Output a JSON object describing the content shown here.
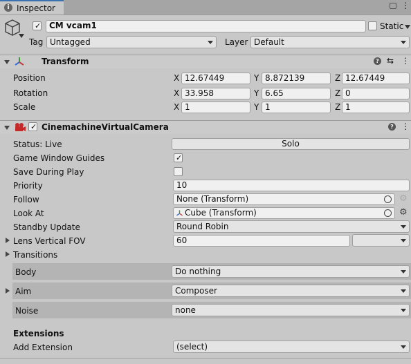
{
  "tab": {
    "label": "Inspector",
    "icon": "info-icon"
  },
  "object": {
    "name": "CM vcam1",
    "static_label": "Static",
    "tag_label": "Tag",
    "tag_value": "Untagged",
    "layer_label": "Layer",
    "layer_value": "Default"
  },
  "transform": {
    "title": "Transform",
    "rows": [
      {
        "label": "Position",
        "x": "12.67449",
        "y": "8.872139",
        "z": "12.67449"
      },
      {
        "label": "Rotation",
        "x": "33.958",
        "y": "6.65",
        "z": "0"
      },
      {
        "label": "Scale",
        "x": "1",
        "y": "1",
        "z": "1"
      }
    ],
    "axis_labels": {
      "x": "X",
      "y": "Y",
      "z": "Z"
    }
  },
  "vcam": {
    "title": "CinemachineVirtualCamera",
    "status_label": "Status: Live",
    "solo_label": "Solo",
    "game_window_guides_label": "Game Window Guides",
    "save_during_play_label": "Save During Play",
    "priority_label": "Priority",
    "priority_value": "10",
    "follow_label": "Follow",
    "follow_value": "None (Transform)",
    "look_at_label": "Look At",
    "look_at_value": "Cube (Transform)",
    "standby_label": "Standby Update",
    "standby_value": "Round Robin",
    "lens_label": "Lens Vertical FOV",
    "lens_value": "60",
    "transitions_label": "Transitions",
    "body_label": "Body",
    "body_value": "Do nothing",
    "aim_label": "Aim",
    "aim_value": "Composer",
    "noise_label": "Noise",
    "noise_value": "none",
    "extensions_label": "Extensions",
    "add_extension_label": "Add Extension",
    "add_extension_value": "(select)"
  },
  "colors": {
    "accent": "#3a72b0",
    "panel": "#c8c8c8"
  }
}
